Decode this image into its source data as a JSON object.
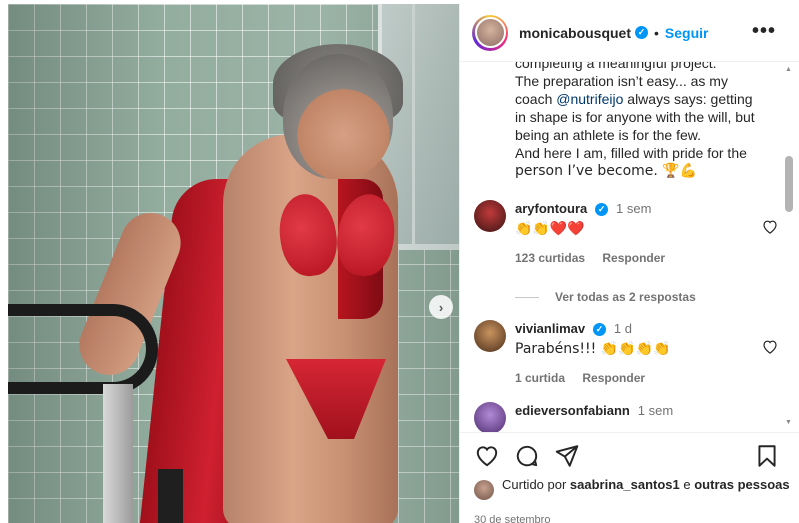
{
  "post": {
    "username": "monicabousquet",
    "verified_badge": "✓",
    "separator": "•",
    "follow_label": "Seguir",
    "more_label": "•••",
    "next_label": "›"
  },
  "caption": {
    "line1": "completing a meaningful project.",
    "line2": "The preparation isn’t easy... as my",
    "line3_pre": "coach ",
    "mention": "@nutrifeijo",
    "line3_post": " always says: getting",
    "line4": "in shape is for anyone with the will, but",
    "line5": "being an athlete is for the few.",
    "line6": "And here I am, filled with pride for the",
    "line7": "person I’ve become. 🏆💪"
  },
  "comments": [
    {
      "username": "aryfontoura",
      "verified": true,
      "time": "1 sem",
      "text": "👏👏❤️❤️",
      "likes_label": "123 curtidas",
      "reply_label": "Responder",
      "view_replies": "Ver todas as 2 respostas"
    },
    {
      "username": "vivianlimav",
      "verified": true,
      "time": "1 d",
      "text": "Parabéns!!! 👏👏👏👏",
      "likes_label": "1 curtida",
      "reply_label": "Responder"
    },
    {
      "username": "edieversonfabiann",
      "verified": false,
      "time": "1 sem"
    }
  ],
  "liked_by": {
    "prefix": "Curtido por ",
    "user": "saabrina_santos1",
    "middle": " e ",
    "others": "outras pessoas"
  },
  "date": "30 de setembro",
  "icons": {
    "like": "heart-icon",
    "comment": "comment-icon",
    "share": "share-icon",
    "save": "bookmark-icon"
  },
  "colors": {
    "accent": "#0095f6",
    "link": "#00376b",
    "muted": "#737373"
  }
}
